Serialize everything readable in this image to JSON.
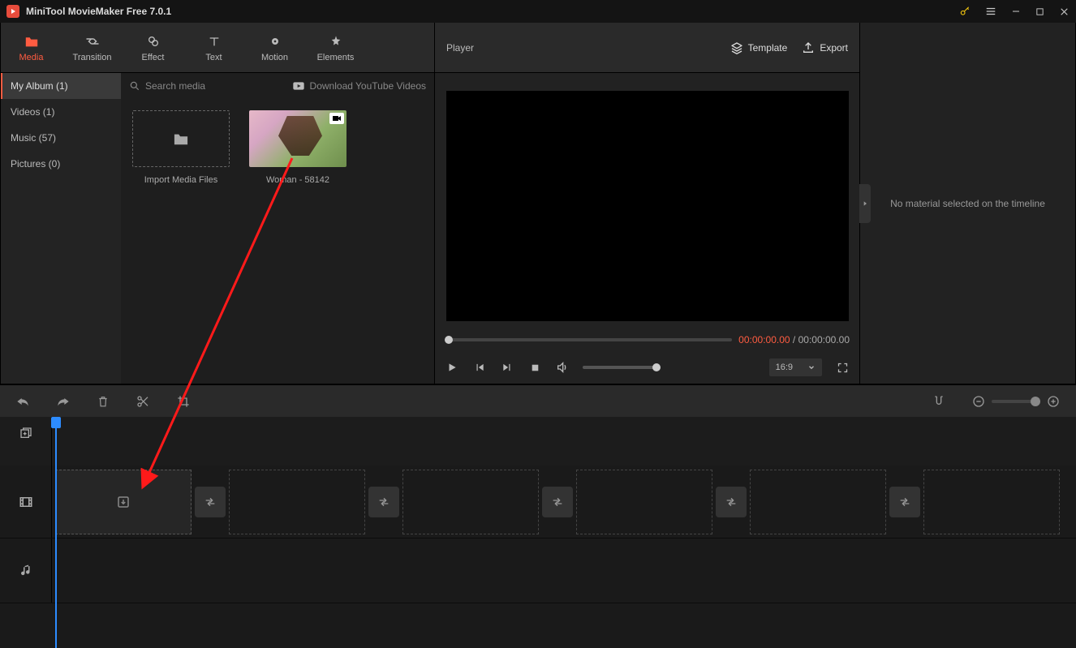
{
  "window": {
    "title": "MiniTool MovieMaker Free 7.0.1"
  },
  "tabs": [
    {
      "label": "Media",
      "active": true
    },
    {
      "label": "Transition"
    },
    {
      "label": "Effect"
    },
    {
      "label": "Text"
    },
    {
      "label": "Motion"
    },
    {
      "label": "Elements"
    }
  ],
  "sidebar": {
    "items": [
      {
        "label": "My Album (1)",
        "active": true
      },
      {
        "label": "Videos (1)"
      },
      {
        "label": "Music (57)"
      },
      {
        "label": "Pictures (0)"
      }
    ]
  },
  "media": {
    "search_placeholder": "Search media",
    "download_label": "Download YouTube Videos",
    "import_label": "Import Media Files",
    "clips": [
      {
        "name": "Woman - 58142",
        "type": "video"
      }
    ]
  },
  "player": {
    "title": "Player",
    "template_label": "Template",
    "export_label": "Export",
    "time_current": "00:00:00.00",
    "time_sep": " / ",
    "time_duration": "00:00:00.00",
    "aspect": "16:9"
  },
  "rightpanel": {
    "no_selection": "No material selected on the timeline"
  },
  "colors": {
    "accent": "#ff5c41",
    "playhead": "#2d8cff"
  }
}
